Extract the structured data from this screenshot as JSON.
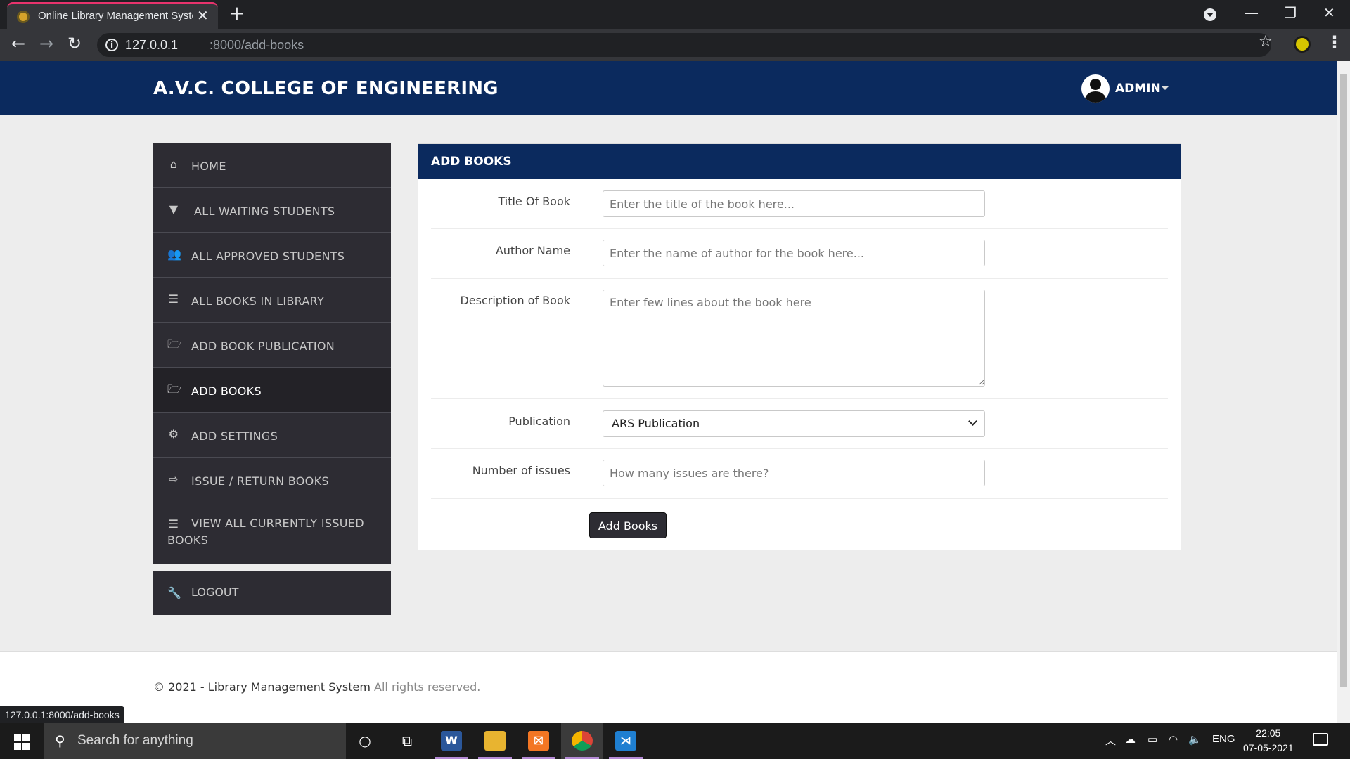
{
  "browser": {
    "tab_title": "Online Library Management System",
    "tab_close": "✕",
    "new_tab": "+",
    "url_host": "127.0.0.1",
    "url_path": ":8000/add-books",
    "status_url": "127.0.0.1:8000/add-books",
    "window_controls": {
      "minimize": "—",
      "restore": "❐",
      "close": "✕"
    }
  },
  "header": {
    "brand": "A.V.C. COLLEGE OF ENGINEERING",
    "user": "ADMIN"
  },
  "sidebar": {
    "items": [
      {
        "label": "HOME",
        "icon": "home-icon",
        "glyph": "⌂",
        "active": false
      },
      {
        "label": "ALL WAITING STUDENTS",
        "icon": "filter-icon",
        "glyph": "▼",
        "active": false
      },
      {
        "label": "ALL APPROVED STUDENTS",
        "icon": "users-icon",
        "glyph": "👥",
        "active": false
      },
      {
        "label": "ALL BOOKS IN LIBRARY",
        "icon": "list-icon",
        "glyph": "☰",
        "active": false
      },
      {
        "label": "ADD BOOK PUBLICATION",
        "icon": "folder-open-icon",
        "glyph": "🗁",
        "active": false
      },
      {
        "label": "ADD BOOKS",
        "icon": "folder-open-icon",
        "glyph": "🗁",
        "active": true
      },
      {
        "label": "ADD SETTINGS",
        "icon": "gear-icon",
        "glyph": "⚙",
        "active": false
      },
      {
        "label": "ISSUE / RETURN BOOKS",
        "icon": "share-icon",
        "glyph": "⇨",
        "active": false
      },
      {
        "label": "VIEW ALL CURRENTLY ISSUED BOOKS",
        "icon": "list-icon",
        "glyph": "☰",
        "active": false
      }
    ],
    "logout": {
      "label": "LOGOUT",
      "icon": "wrench-icon",
      "glyph": "🔧"
    }
  },
  "panel": {
    "title": "ADD BOOKS",
    "fields": {
      "title": {
        "label": "Title Of Book",
        "placeholder": "Enter the title of the book here...",
        "value": ""
      },
      "author": {
        "label": "Author Name",
        "placeholder": "Enter the name of author for the book here...",
        "value": ""
      },
      "description": {
        "label": "Description of Book",
        "placeholder": "Enter few lines about the book here",
        "value": ""
      },
      "publication": {
        "label": "Publication",
        "selected": "ARS Publication"
      },
      "issues": {
        "label": "Number of issues",
        "placeholder": "How many issues are there?",
        "value": ""
      }
    },
    "submit_label": "Add Books"
  },
  "footer": {
    "copyright": "© 2021 - Library Management System",
    "rights": "All rights reserved."
  },
  "taskbar": {
    "search_placeholder": "Search for anything",
    "language": "ENG",
    "time": "22:05",
    "date": "07-05-2021",
    "apps": [
      "cortana-icon",
      "task-view-icon",
      "word-icon",
      "file-explorer-icon",
      "xampp-icon",
      "chrome-icon",
      "vscode-icon"
    ]
  },
  "colors": {
    "brand_navy": "#0b2a5e",
    "sidebar_dark": "#2d2c33",
    "sidebar_active": "#232227",
    "page_bg": "#ededed"
  }
}
